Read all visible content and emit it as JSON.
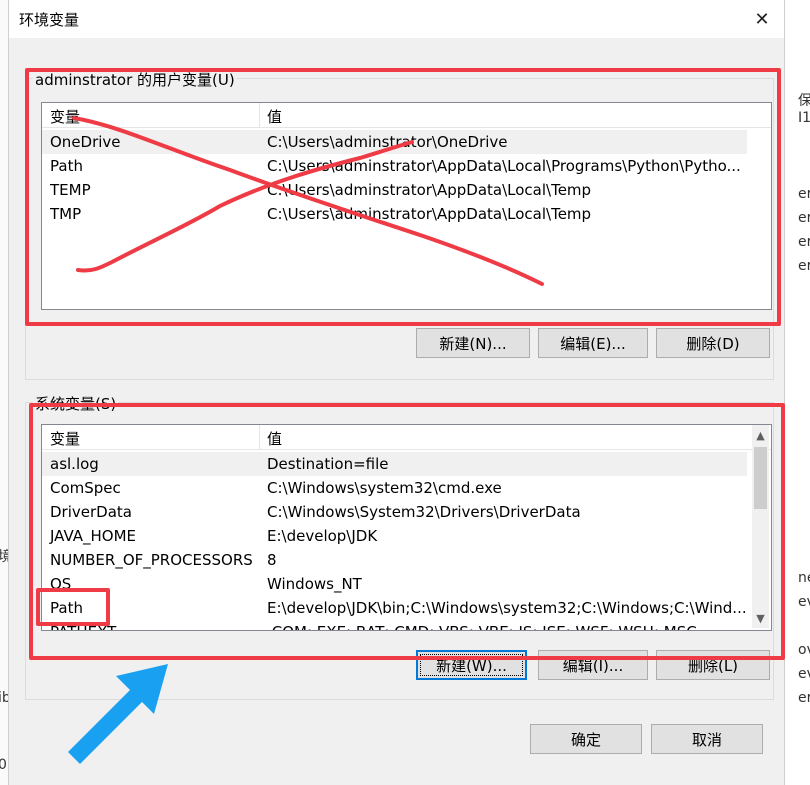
{
  "background": {
    "right_fragments": [
      "保",
      "I1",
      "er",
      "er",
      "er",
      "er",
      "ne",
      "ev",
      "ov",
      "ev",
      "er"
    ],
    "left_fragments": [
      "境",
      "ib",
      "0"
    ]
  },
  "dialog": {
    "title": "环境变量",
    "close_glyph": "✕"
  },
  "user_vars": {
    "group_label": "adminstrator 的用户变量(U)",
    "headers": {
      "name": "变量",
      "value": "值"
    },
    "rows": [
      {
        "name": "OneDrive",
        "value": "C:\\Users\\adminstrator\\OneDrive"
      },
      {
        "name": "Path",
        "value": "C:\\Users\\adminstrator\\AppData\\Local\\Programs\\Python\\Pytho..."
      },
      {
        "name": "TEMP",
        "value": "C:\\Users\\adminstrator\\AppData\\Local\\Temp"
      },
      {
        "name": "TMP",
        "value": "C:\\Users\\adminstrator\\AppData\\Local\\Temp"
      }
    ],
    "buttons": {
      "new": "新建(N)...",
      "edit": "编辑(E)...",
      "delete": "删除(D)"
    }
  },
  "system_vars": {
    "group_label": "系统变量(S)",
    "headers": {
      "name": "变量",
      "value": "值"
    },
    "rows": [
      {
        "name": "asl.log",
        "value": "Destination=file"
      },
      {
        "name": "ComSpec",
        "value": "C:\\Windows\\system32\\cmd.exe"
      },
      {
        "name": "DriverData",
        "value": "C:\\Windows\\System32\\Drivers\\DriverData"
      },
      {
        "name": "JAVA_HOME",
        "value": "E:\\develop\\JDK"
      },
      {
        "name": "NUMBER_OF_PROCESSORS",
        "value": "8"
      },
      {
        "name": "OS",
        "value": "Windows_NT"
      },
      {
        "name": "Path",
        "value": "E:\\develop\\JDK\\bin;C:\\Windows\\system32;C:\\Windows;C:\\Wind..."
      },
      {
        "name": "PATHEXT",
        "value": ".COM;.EXE;.BAT;.CMD;.VBS;.VBE;.JS;.JSE;.WSF;.WSH;.MSC"
      }
    ],
    "buttons": {
      "new": "新建(W)...",
      "edit": "编辑(I)...",
      "delete": "删除(L)"
    },
    "scroll": {
      "up": "▲",
      "down": "▼"
    }
  },
  "footer": {
    "ok": "确定",
    "cancel": "取消"
  },
  "annotation_colors": {
    "red": "#ee3b45",
    "blue": "#1aa0f0"
  }
}
